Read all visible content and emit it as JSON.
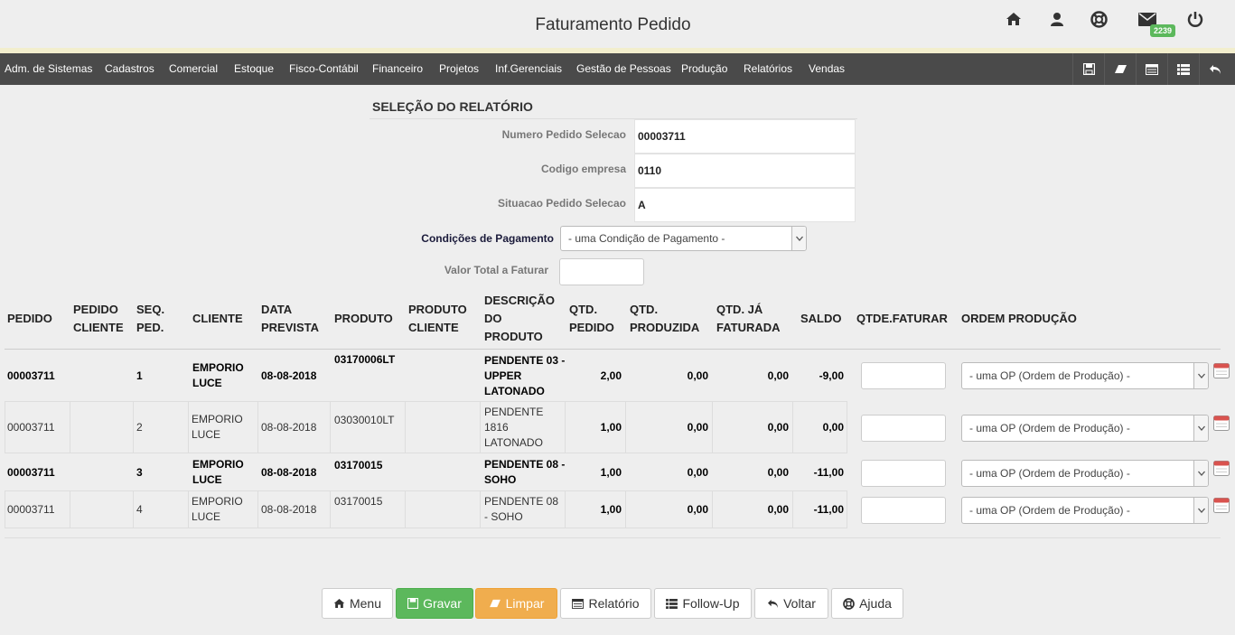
{
  "header": {
    "title": "Faturamento Pedido",
    "mail_count": "2239"
  },
  "menu": {
    "items": [
      "Adm. de Sistemas",
      "Cadastros",
      "Comercial",
      "Estoque",
      "Fisco-Contábil",
      "Financeiro",
      "Projetos",
      "Inf.Gerenciais",
      "Gestão de Pessoas",
      "Produção",
      "Relatórios",
      "Vendas"
    ]
  },
  "form": {
    "section_title": "SELEÇÃO DO RELATÓRIO",
    "fields": [
      {
        "label": "Numero Pedido Selecao",
        "value": "00003711"
      },
      {
        "label": "Codigo empresa",
        "value": "0110"
      },
      {
        "label": "Situacao Pedido Selecao",
        "value": "A"
      }
    ],
    "payment_label": "Condições de Pagamento",
    "payment_placeholder": "- uma Condição de Pagamento -",
    "total_label": "Valor Total a Faturar",
    "total_value": ""
  },
  "table": {
    "headers": {
      "pedido": "PEDIDO",
      "pedido_cliente": "PEDIDO CLIENTE",
      "seq": "SEQ. PED.",
      "cliente": "CLIENTE",
      "data": "DATA PREVISTA",
      "produto": "PRODUTO",
      "produto_cliente": "PRODUTO CLIENTE",
      "descricao": "DESCRIÇÃO DO PRODUTO",
      "qtd_pedido": "QTD. PEDIDO",
      "qtd_produzida": "QTD. PRODUZIDA",
      "qtd_faturada": "QTD. JÁ FATURADA",
      "saldo": "SALDO",
      "qtde_faturar": "QTDE.FATURAR",
      "ordem": "ORDEM PRODUÇÃO"
    },
    "op_placeholder": "- uma OP (Ordem de Produção) -",
    "rows": [
      {
        "pedido": "00003711",
        "pedido_cliente": "",
        "seq": "1",
        "cliente": "EMPORIO LUCE",
        "data": "08-08-2018",
        "produto": "03170006LT",
        "produto_cliente": "",
        "descricao": "PENDENTE 03 - UPPER LATONADO",
        "qtd_pedido": "2,00",
        "qtd_produzida": "0,00",
        "qtd_faturada": "0,00",
        "saldo": "-9,00",
        "bold": true
      },
      {
        "pedido": "00003711",
        "pedido_cliente": "",
        "seq": "2",
        "cliente": "EMPORIO LUCE",
        "data": "08-08-2018",
        "produto": "03030010LT",
        "produto_cliente": "",
        "descricao": "PENDENTE 1816 LATONADO",
        "qtd_pedido": "1,00",
        "qtd_produzida": "0,00",
        "qtd_faturada": "0,00",
        "saldo": "0,00",
        "bold": false
      },
      {
        "pedido": "00003711",
        "pedido_cliente": "",
        "seq": "3",
        "cliente": "EMPORIO LUCE",
        "data": "08-08-2018",
        "produto": "03170015",
        "produto_cliente": "",
        "descricao": "PENDENTE 08 - SOHO",
        "qtd_pedido": "1,00",
        "qtd_produzida": "0,00",
        "qtd_faturada": "0,00",
        "saldo": "-11,00",
        "bold": true
      },
      {
        "pedido": "00003711",
        "pedido_cliente": "",
        "seq": "4",
        "cliente": "EMPORIO LUCE",
        "data": "08-08-2018",
        "produto": "03170015",
        "produto_cliente": "",
        "descricao": "PENDENTE 08 - SOHO",
        "qtd_pedido": "1,00",
        "qtd_produzida": "0,00",
        "qtd_faturada": "0,00",
        "saldo": "-11,00",
        "bold": false
      }
    ]
  },
  "buttons": {
    "menu": "Menu",
    "gravar": "Gravar",
    "limpar": "Limpar",
    "relatorio": "Relatório",
    "followup": "Follow-Up",
    "voltar": "Voltar",
    "ajuda": "Ajuda"
  },
  "colors": {
    "menubar": "#4a4a4a",
    "green": "#5cb85c",
    "orange": "#f0ad4e",
    "accent": "#f2eecd"
  }
}
